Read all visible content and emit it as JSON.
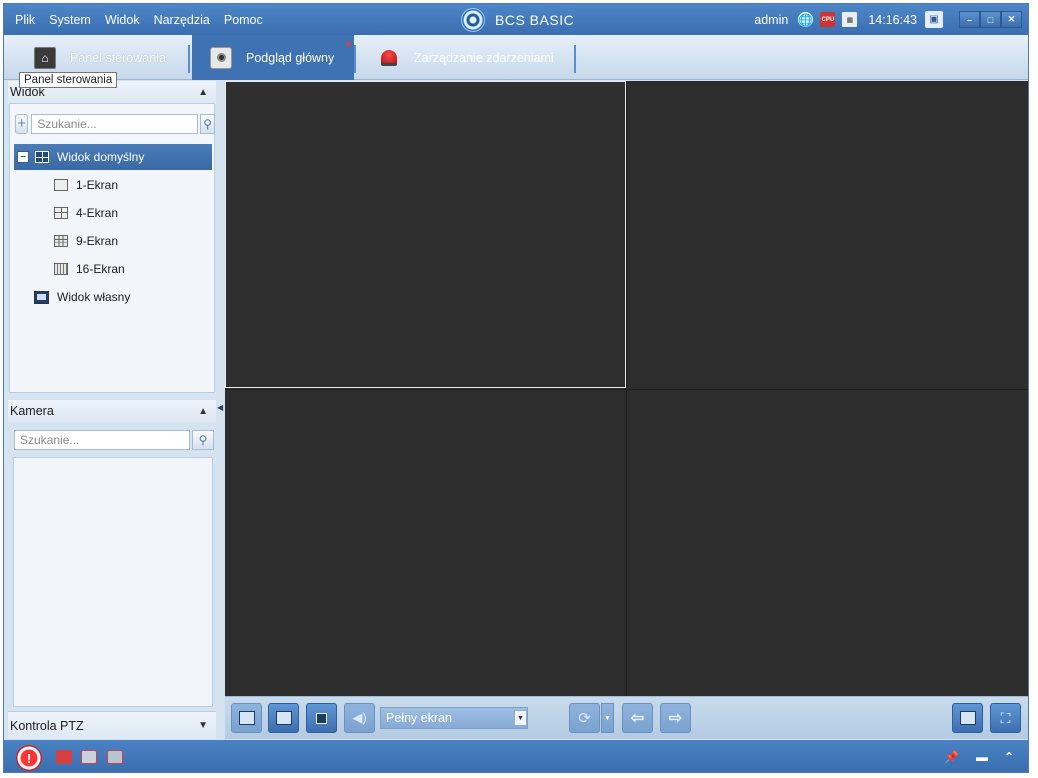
{
  "menu": [
    "Plik",
    "System",
    "Widok",
    "Narzędzia",
    "Pomoc"
  ],
  "app_title": "BCS BASIC",
  "status": {
    "user": "admin",
    "clock": "14:16:43",
    "cpu_label": "CPU"
  },
  "tabs": [
    {
      "label": "Panel sterowania",
      "icon": "home-icon"
    },
    {
      "label": "Podgląd główny",
      "icon": "camera-icon"
    },
    {
      "label": "Zarządzanie zdarzeniami",
      "icon": "alarm-light-icon"
    }
  ],
  "tooltip": "Panel sterowania",
  "view_section": {
    "title": "Widok",
    "search_placeholder": "Szukanie...",
    "root": "Widok domyślny",
    "items": [
      "1-Ekran",
      "4-Ekran",
      "9-Ekran",
      "16-Ekran"
    ],
    "custom": "Widok własny"
  },
  "camera_section": {
    "title": "Kamera",
    "search_placeholder": "Szukanie..."
  },
  "ptz_section": {
    "title": "Kontrola PTZ"
  },
  "toolbar": {
    "screen_mode": "Pełny ekran"
  },
  "colors": {
    "accent": "#3e72b2",
    "titlebar": "#3a6fb1",
    "video_bg": "#2d2d2d",
    "alarm": "#d21e1e"
  }
}
